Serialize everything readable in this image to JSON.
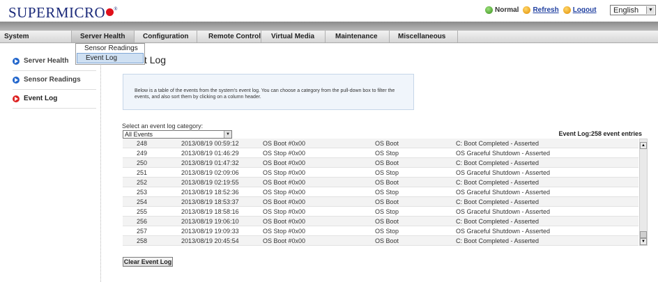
{
  "brand": {
    "logo_text": "SUPERMICRO"
  },
  "header": {
    "status_label": "Normal",
    "refresh_label": "Refresh",
    "logout_label": "Logout",
    "language": "English"
  },
  "menu": [
    {
      "label": "System"
    },
    {
      "label": "Server Health"
    },
    {
      "label": "Configuration"
    },
    {
      "label": "Remote Control"
    },
    {
      "label": "Virtual Media"
    },
    {
      "label": "Maintenance"
    },
    {
      "label": "Miscellaneous"
    }
  ],
  "dropdown": {
    "items": [
      {
        "label": "Sensor Readings"
      },
      {
        "label": "Event Log"
      }
    ]
  },
  "sidebar": {
    "items": [
      {
        "label": "Server Health"
      },
      {
        "label": "Sensor Readings"
      },
      {
        "label": "Event Log"
      }
    ]
  },
  "page": {
    "title": "Event Log",
    "info_text": "Below is a table of the events from the system's event log. You can choose a category from the pull-down box to filter the events, and also sort them by clicking on a column header.",
    "category_label": "Select an event log category:",
    "category_value": "All Events",
    "count_text": "Event Log:258 event entries",
    "clear_button": "Clear Event Log"
  },
  "events": [
    {
      "id": "248",
      "time": "2013/08/19 00:59:12",
      "sensor": "OS Boot #0x00",
      "type": "OS Boot",
      "desc": "C: Boot Completed - Asserted"
    },
    {
      "id": "249",
      "time": "2013/08/19 01:46:29",
      "sensor": "OS Stop #0x00",
      "type": "OS Stop",
      "desc": "OS Graceful Shutdown - Asserted"
    },
    {
      "id": "250",
      "time": "2013/08/19 01:47:32",
      "sensor": "OS Boot #0x00",
      "type": "OS Boot",
      "desc": "C: Boot Completed - Asserted"
    },
    {
      "id": "251",
      "time": "2013/08/19 02:09:06",
      "sensor": "OS Stop #0x00",
      "type": "OS Stop",
      "desc": "OS Graceful Shutdown - Asserted"
    },
    {
      "id": "252",
      "time": "2013/08/19 02:19:55",
      "sensor": "OS Boot #0x00",
      "type": "OS Boot",
      "desc": "C: Boot Completed - Asserted"
    },
    {
      "id": "253",
      "time": "2013/08/19 18:52:36",
      "sensor": "OS Stop #0x00",
      "type": "OS Stop",
      "desc": "OS Graceful Shutdown - Asserted"
    },
    {
      "id": "254",
      "time": "2013/08/19 18:53:37",
      "sensor": "OS Boot #0x00",
      "type": "OS Boot",
      "desc": "C: Boot Completed - Asserted"
    },
    {
      "id": "255",
      "time": "2013/08/19 18:58:16",
      "sensor": "OS Stop #0x00",
      "type": "OS Stop",
      "desc": "OS Graceful Shutdown - Asserted"
    },
    {
      "id": "256",
      "time": "2013/08/19 19:06:10",
      "sensor": "OS Boot #0x00",
      "type": "OS Boot",
      "desc": "C: Boot Completed - Asserted"
    },
    {
      "id": "257",
      "time": "2013/08/19 19:09:33",
      "sensor": "OS Stop #0x00",
      "type": "OS Stop",
      "desc": "OS Graceful Shutdown - Asserted"
    },
    {
      "id": "258",
      "time": "2013/08/19 20:45:54",
      "sensor": "OS Boot #0x00",
      "type": "OS Boot",
      "desc": "C: Boot Completed - Asserted"
    }
  ]
}
